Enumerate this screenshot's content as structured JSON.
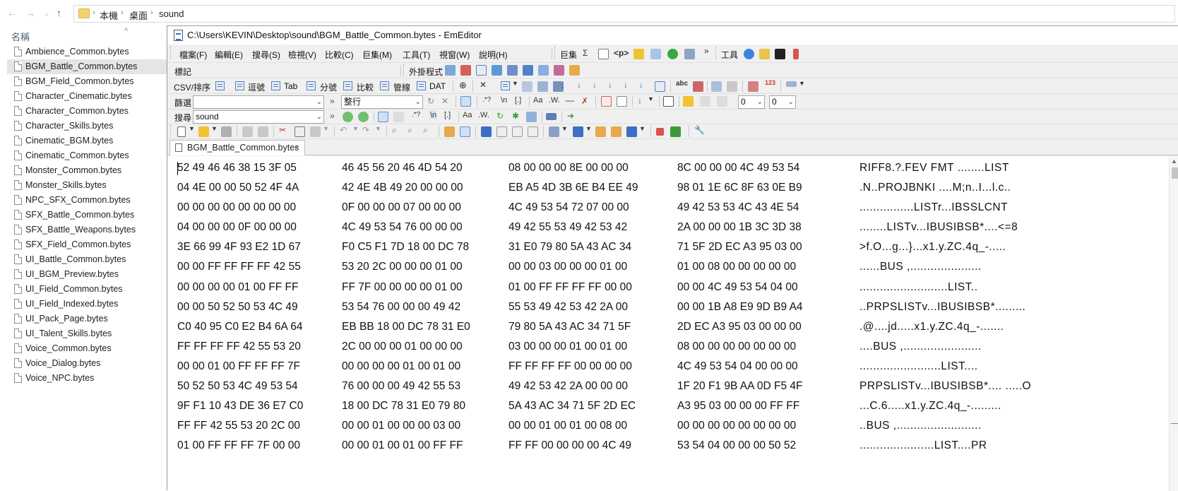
{
  "explorer": {
    "breadcrumb": [
      "本機",
      "桌面",
      "sound"
    ],
    "column_header": "名稱",
    "files": [
      "Ambience_Common.bytes",
      "BGM_Battle_Common.bytes",
      "BGM_Field_Common.bytes",
      "Character_Cinematic.bytes",
      "Character_Common.bytes",
      "Character_Skills.bytes",
      "Cinematic_BGM.bytes",
      "Cinematic_Common.bytes",
      "Monster_Common.bytes",
      "Monster_Skills.bytes",
      "NPC_SFX_Common.bytes",
      "SFX_Battle_Common.bytes",
      "SFX_Battle_Weapons.bytes",
      "SFX_Field_Common.bytes",
      "UI_Battle_Common.bytes",
      "UI_BGM_Preview.bytes",
      "UI_Field_Common.bytes",
      "UI_Field_Indexed.bytes",
      "UI_Pack_Page.bytes",
      "UI_Talent_Skills.bytes",
      "Voice_Common.bytes",
      "Voice_Dialog.bytes",
      "Voice_NPC.bytes"
    ],
    "selected_file": "BGM_Battle_Common.bytes"
  },
  "editor": {
    "title": "C:\\Users\\KEVIN\\Desktop\\sound\\BGM_Battle_Common.bytes - EmEditor",
    "menu": [
      "檔案(F)",
      "編輯(E)",
      "搜尋(S)",
      "檢視(V)",
      "比較(C)",
      "巨集(M)",
      "工具(T)",
      "視窗(W)",
      "說明(H)"
    ],
    "macro_toolbar_label": "巨集",
    "tools_toolbar_label": "工具",
    "bookmark_label": "標記",
    "plugins_label": "外掛程式",
    "csv_toolbar": {
      "label": "CSV/排序",
      "buttons": [
        "逗號",
        "Tab",
        "分號",
        "比較",
        "管線",
        "DAT"
      ]
    },
    "filter": {
      "label": "篩選",
      "value": "",
      "mode": "整行",
      "num1": "0",
      "num2": "0"
    },
    "search": {
      "label": "搜尋",
      "value": "sound"
    },
    "tab_label": "BGM_Battle_Common.bytes",
    "hex_rows": [
      {
        "hex": [
          "52 49 46 46 38 15 3F 05",
          "46 45 56 20 46 4D 54 20",
          "08 00 00 00 8E 00 00 00",
          "8C 00 00 00 4C 49 53 54"
        ],
        "text": "RIFF8.?.FEV FMT ........LIST"
      },
      {
        "hex": [
          "04 4E 00 00 50 52 4F 4A",
          "42 4E 4B 49 20 00 00 00",
          "EB A5 4D 3B 6E B4 EE 49",
          "98 01 1E 6C 8F 63 0E B9"
        ],
        "text": ".N..PROJBNKI ....M;n..I...l.c.."
      },
      {
        "hex": [
          "00 00 00 00 00 00 00 00",
          "0F 00 00 00 07 00 00 00",
          "4C 49 53 54 72 07 00 00",
          "49 42 53 53 4C 43 4E 54"
        ],
        "text": "................LISTr...IBSSLCNT"
      },
      {
        "hex": [
          "04 00 00 00 0F 00 00 00",
          "4C 49 53 54 76 00 00 00",
          "49 42 55 53 49 42 53 42",
          "2A 00 00 00 1B 3C 3D 38"
        ],
        "text": "........LISTv...IBUSIBSB*....<=8"
      },
      {
        "hex": [
          "3E 66 99 4F 93 E2 1D 67",
          "F0 C5 F1 7D 18 00 DC 78",
          "31 E0 79 80 5A 43 AC 34",
          "71 5F 2D EC A3 95 03 00"
        ],
        "text": ">f.O...g...}...x1.y.ZC.4q_-....."
      },
      {
        "hex": [
          "00 00 FF FF FF FF 42 55",
          "53 20 2C 00 00 00 01 00",
          "00 00 03 00 00 00 01 00",
          "01 00 08 00 00 00 00 00"
        ],
        "text": "......BUS ,....................."
      },
      {
        "hex": [
          "00 00 00 00 01 00 FF FF",
          "FF 7F 00 00 00 00 01 00",
          "01 00 FF FF FF FF 00 00",
          "00 00 4C 49 53 54 04 00"
        ],
        "text": "..........................LIST.."
      },
      {
        "hex": [
          "00 00 50 52 50 53 4C 49",
          "53 54 76 00 00 00 49 42",
          "55 53 49 42 53 42 2A 00",
          "00 00 1B A8 E9 9D B9 A4"
        ],
        "text": "..PRPSLISTv...IBUSIBSB*........."
      },
      {
        "hex": [
          "C0 40 95 C0 E2 B4 6A 64",
          "EB BB 18 00 DC 78 31 E0",
          "79 80 5A 43 AC 34 71 5F",
          "2D EC A3 95 03 00 00 00"
        ],
        "text": ".@....jd.....x1.y.ZC.4q_-......."
      },
      {
        "hex": [
          "FF FF FF FF 42 55 53 20",
          "2C 00 00 00 01 00 00 00",
          "03 00 00 00 01 00 01 00",
          "08 00 00 00 00 00 00 00"
        ],
        "text": "....BUS ,......................."
      },
      {
        "hex": [
          "00 00 01 00 FF FF FF 7F",
          "00 00 00 00 01 00 01 00",
          "FF FF FF FF 00 00 00 00",
          "4C 49 53 54 04 00 00 00"
        ],
        "text": "........................LIST...."
      },
      {
        "hex": [
          "50 52 50 53 4C 49 53 54",
          "76 00 00 00 49 42 55 53",
          "49 42 53 42 2A 00 00 00",
          "1F 20 F1 9B AA 0D F5 4F"
        ],
        "text": "PRPSLISTv...IBUSIBSB*.... .....O"
      },
      {
        "hex": [
          "9F F1 10 43 DE 36 E7 C0",
          "18 00 DC 78 31 E0 79 80",
          "5A 43 AC 34 71 5F 2D EC",
          "A3 95 03 00 00 00 FF FF"
        ],
        "text": "...C.6.....x1.y.ZC.4q_-........."
      },
      {
        "hex": [
          "FF FF 42 55 53 20 2C 00",
          "00 00 01 00 00 00 03 00",
          "00 00 01 00 01 00 08 00",
          "00 00 00 00 00 00 00 00"
        ],
        "text": "..BUS ,........................."
      },
      {
        "hex": [
          "01 00 FF FF FF 7F 00 00",
          "00 00 01 00 01 00 FF FF",
          "FF FF 00 00 00 00 4C 49",
          "53 54 04 00 00 00 50 52"
        ],
        "text": "......................LIST....PR"
      }
    ]
  }
}
